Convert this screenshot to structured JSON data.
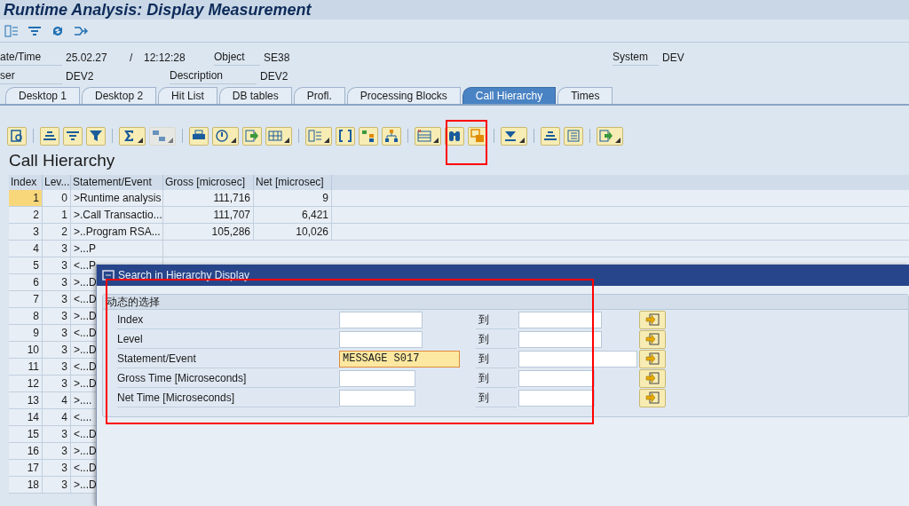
{
  "window": {
    "title": "Runtime Analysis: Display Measurement"
  },
  "app_toolbar": {
    "buttons": [
      {
        "kind": "layout"
      },
      {
        "kind": "filter"
      },
      {
        "kind": "refresh"
      },
      {
        "kind": "split"
      }
    ]
  },
  "header_fields": [
    {
      "label": "ate/Time",
      "value": "25.02.27",
      "separator": "/",
      "value_2": "12:12:28",
      "label_2": "Object",
      "value_3": "SE38",
      "label_3": "System",
      "value_4": "DEV"
    },
    {
      "label": "ser",
      "value": "DEV2",
      "label_2": "Description",
      "value_3": "DEV2"
    }
  ],
  "tabs": [
    {
      "label": "Desktop 1",
      "selected": false
    },
    {
      "label": "Desktop 2",
      "selected": false
    },
    {
      "label": "Hit List",
      "selected": false
    },
    {
      "label": "DB tables",
      "selected": false
    },
    {
      "label": "Profl.",
      "selected": false
    },
    {
      "label": "Processing Blocks",
      "selected": false
    },
    {
      "label": "Call Hierarchy",
      "selected": true
    },
    {
      "label": "Times",
      "selected": false
    }
  ],
  "toolbar": {
    "buttons": [
      {
        "kind": "detail",
        "dropdown": false,
        "disabled": false
      },
      {
        "kind": "center",
        "dropdown": false,
        "disabled": false
      },
      {
        "kind": "filter",
        "dropdown": false,
        "disabled": false
      },
      {
        "kind": "funnel",
        "dropdown": false,
        "disabled": false
      },
      {
        "kind": "sum",
        "dropdown": true,
        "disabled": false
      },
      {
        "kind": "subtotal",
        "dropdown": true,
        "disabled": true
      },
      {
        "kind": "print",
        "dropdown": false,
        "disabled": false
      },
      {
        "kind": "view",
        "dropdown": true,
        "disabled": false
      },
      {
        "kind": "export",
        "dropdown": false,
        "disabled": false
      },
      {
        "kind": "grid",
        "dropdown": true,
        "disabled": false
      },
      {
        "kind": "layout",
        "dropdown": true,
        "disabled": false
      },
      {
        "kind": "bracket",
        "dropdown": false,
        "disabled": false
      },
      {
        "kind": "tree",
        "dropdown": false,
        "disabled": false
      },
      {
        "kind": "hierarchy",
        "dropdown": false,
        "disabled": false
      },
      {
        "kind": "table",
        "dropdown": true,
        "disabled": false
      },
      {
        "kind": "find",
        "dropdown": false,
        "disabled": false
      },
      {
        "kind": "findnext",
        "dropdown": false,
        "disabled": false
      },
      {
        "kind": "collapse",
        "dropdown": true,
        "disabled": false
      },
      {
        "kind": "center",
        "dropdown": false,
        "disabled": false
      },
      {
        "kind": "list",
        "dropdown": false,
        "disabled": false
      },
      {
        "kind": "export",
        "dropdown": true,
        "disabled": false
      }
    ]
  },
  "section_title": "Call Hierarchy",
  "table": {
    "columns": [
      "Index",
      "Lev...",
      "Statement/Event",
      "Gross [microsec]",
      "Net [microsec]"
    ],
    "rows": [
      {
        "selected": true,
        "cells": [
          "1",
          "0",
          ">Runtime analysis",
          "111,716",
          "9"
        ]
      },
      {
        "selected": false,
        "cells": [
          "2",
          "1",
          ">.Call Transactio...",
          "111,707",
          "6,421"
        ]
      },
      {
        "selected": false,
        "cells": [
          "3",
          "2",
          ">..Program RSA...",
          "105,286",
          "10,026"
        ]
      },
      {
        "selected": false,
        "cells": [
          "4",
          "3",
          ">...P"
        ]
      },
      {
        "selected": false,
        "cells": [
          "5",
          "3",
          "<...P"
        ]
      },
      {
        "selected": false,
        "cells": [
          "6",
          "3",
          ">...D"
        ]
      },
      {
        "selected": false,
        "cells": [
          "7",
          "3",
          "<...D"
        ]
      },
      {
        "selected": false,
        "cells": [
          "8",
          "3",
          ">...D"
        ]
      },
      {
        "selected": false,
        "cells": [
          "9",
          "3",
          "<...D"
        ]
      },
      {
        "selected": false,
        "cells": [
          "10",
          "3",
          ">...D"
        ]
      },
      {
        "selected": false,
        "cells": [
          "11",
          "3",
          "<...D"
        ]
      },
      {
        "selected": false,
        "cells": [
          "12",
          "3",
          ">...D"
        ]
      },
      {
        "selected": false,
        "cells": [
          "13",
          "4",
          ">...."
        ]
      },
      {
        "selected": false,
        "cells": [
          "14",
          "4",
          "<...."
        ]
      },
      {
        "selected": false,
        "cells": [
          "15",
          "3",
          "<...D"
        ]
      },
      {
        "selected": false,
        "cells": [
          "16",
          "3",
          ">...D"
        ]
      },
      {
        "selected": false,
        "cells": [
          "17",
          "3",
          "<...D"
        ]
      },
      {
        "selected": false,
        "cells": [
          "18",
          "3",
          ">...D"
        ]
      }
    ]
  },
  "dialog": {
    "title": "Search in Hierarchy Display",
    "group_title": "动态的选择",
    "rows": [
      {
        "label": "Index",
        "to_label": "到",
        "focused": false
      },
      {
        "label": "Level",
        "to_label": "到",
        "focused": false
      },
      {
        "label": "Statement/Event",
        "value": "MESSAGE S017",
        "to_label": "到",
        "focused": true
      },
      {
        "label": "Gross Time [Microseconds]",
        "to_label": "到",
        "focused": false
      },
      {
        "label": "Net Time [Microseconds]",
        "to_label": "到",
        "focused": false
      }
    ]
  }
}
